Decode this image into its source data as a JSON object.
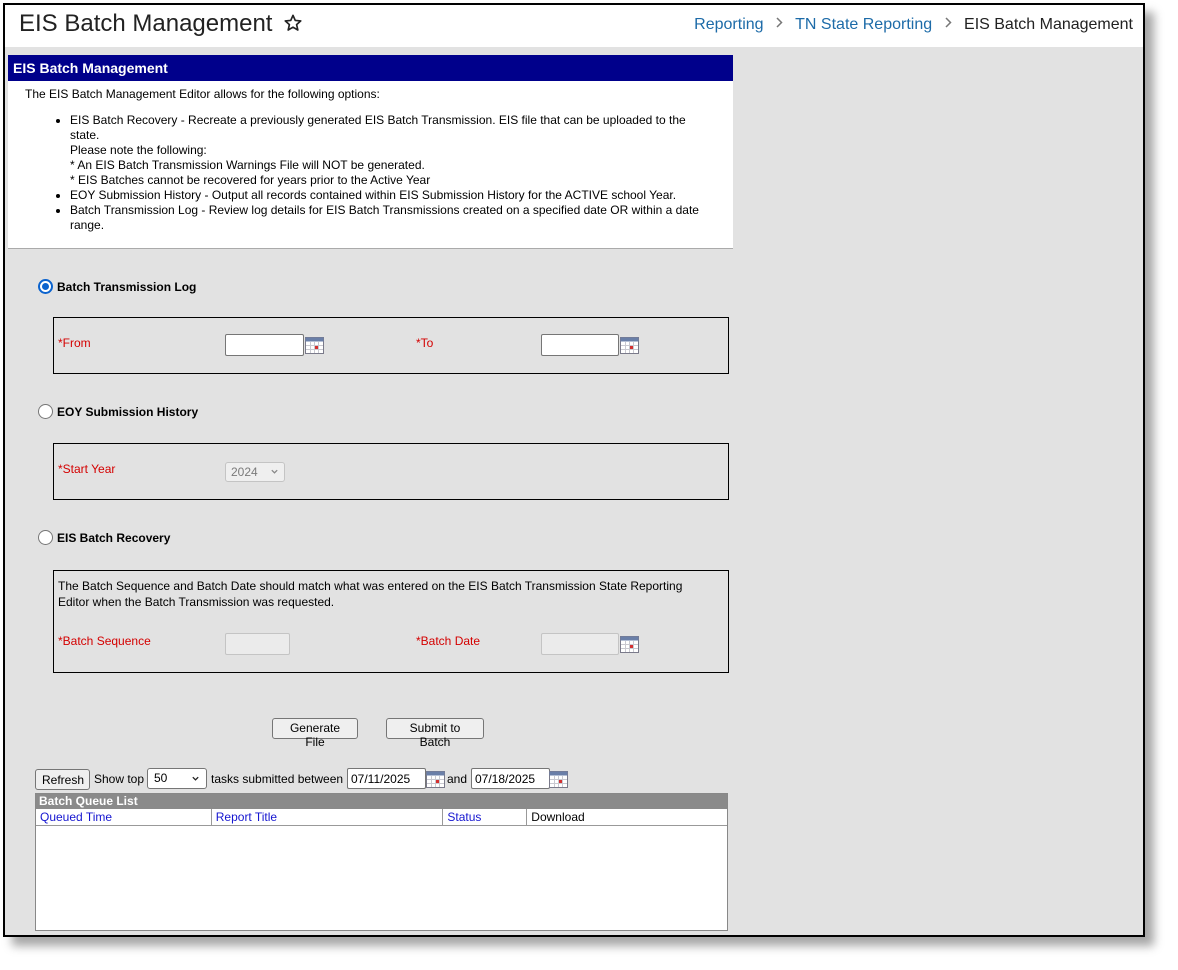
{
  "title": "EIS Batch Management",
  "breadcrumb": [
    "Reporting",
    "TN State Reporting",
    "EIS Batch Management"
  ],
  "editor": {
    "header": "EIS Batch Management",
    "intro": "The EIS Batch Management Editor allows for the following options:",
    "options": [
      "EIS Batch Recovery - Recreate a previously generated EIS Batch Transmission. EIS file that can be uploaded to the state.",
      "EOY Submission History - Output all records contained within EIS Submission History for the ACTIVE school Year.",
      "Batch Transmission Log - Review log details for EIS Batch Transmissions created on a specified date OR within a date range."
    ],
    "notes": [
      "Please note the following:",
      "* An EIS Batch Transmission Warnings File will NOT be generated.",
      "* EIS Batches cannot be recovered for years prior to the Active Year"
    ]
  },
  "transmission_log": {
    "label": "Batch Transmission Log",
    "selected": true,
    "from_label": "*From",
    "from_value": "",
    "to_label": "*To",
    "to_value": ""
  },
  "eoy_history": {
    "label": "EOY Submission History",
    "selected": false,
    "start_year_label": "*Start Year",
    "start_year_value": "2024"
  },
  "batch_recovery": {
    "label": "EIS Batch Recovery",
    "selected": false,
    "info": "The Batch Sequence and Batch Date should match what was entered on the EIS Batch Transmission State Reporting Editor when the Batch Transmission was requested.",
    "sequence_label": "*Batch Sequence",
    "sequence_value": "",
    "date_label": "*Batch Date",
    "date_value": ""
  },
  "actions": {
    "generate": "Generate File",
    "submit": "Submit to Batch"
  },
  "queue": {
    "refresh": "Refresh",
    "show_top": "Show top",
    "top_value": "50",
    "between": "tasks submitted between",
    "start_date": "07/11/2025",
    "and": "and",
    "end_date": "07/18/2025",
    "title": "Batch Queue List",
    "columns": [
      "Queued Time",
      "Report Title",
      "Status",
      "Download"
    ]
  }
}
